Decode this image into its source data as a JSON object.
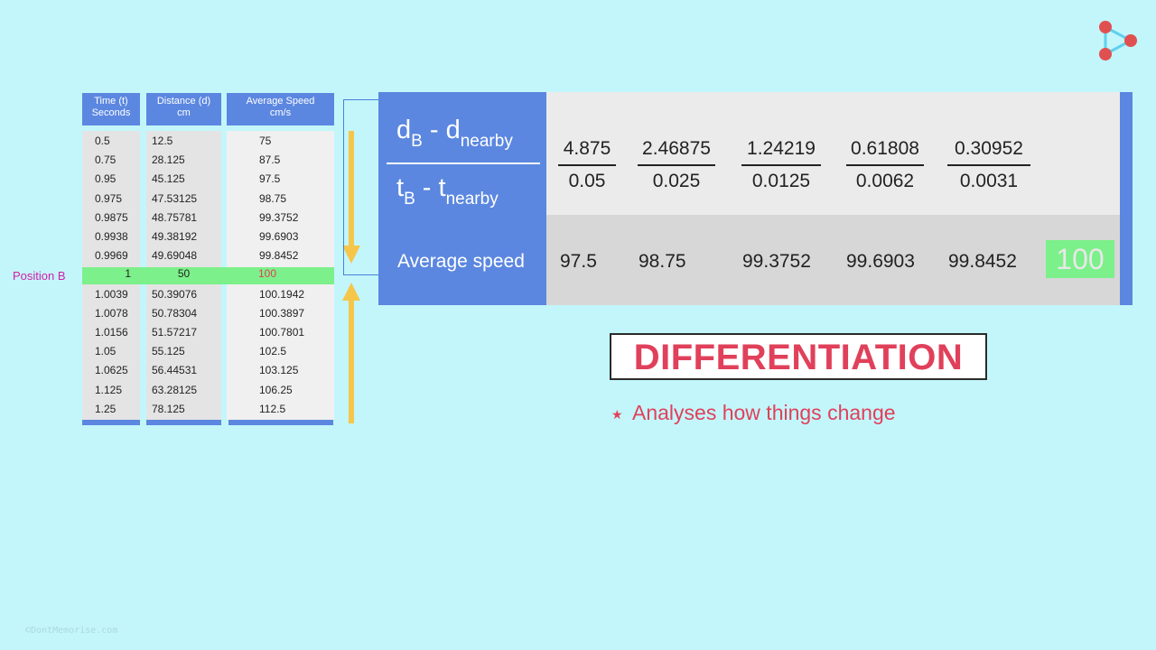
{
  "watermark": "©DontMemorise.com",
  "table": {
    "headers": [
      {
        "line1": "Time (t)",
        "line2": "Seconds"
      },
      {
        "line1": "Distance (d)",
        "line2": "cm"
      },
      {
        "line1": "Average Speed",
        "line2": "cm/s"
      }
    ],
    "rows_above": [
      [
        "0.5",
        "12.5",
        "75"
      ],
      [
        "0.75",
        "28.125",
        "87.5"
      ],
      [
        "0.95",
        "45.125",
        "97.5"
      ],
      [
        "0.975",
        "47.53125",
        "98.75"
      ],
      [
        "0.9875",
        "48.75781",
        "99.3752"
      ],
      [
        "0.9938",
        "49.38192",
        "99.6903"
      ],
      [
        "0.9969",
        "49.69048",
        "99.8452"
      ]
    ],
    "highlight_row": [
      "1",
      "50",
      "100"
    ],
    "rows_below": [
      [
        "1.0039",
        "50.39076",
        "100.1942"
      ],
      [
        "1.0078",
        "50.78304",
        "100.3897"
      ],
      [
        "1.0156",
        "51.57217",
        "100.7801"
      ],
      [
        "1.05",
        "55.125",
        "102.5"
      ],
      [
        "1.0625",
        "56.44531",
        "103.125"
      ],
      [
        "1.125",
        "63.28125",
        "106.25"
      ],
      [
        "1.25",
        "78.125",
        "112.5"
      ]
    ],
    "position_label": "Position B"
  },
  "panel": {
    "num_d": "d",
    "num_sub_b": "B",
    "num_minus": " - d",
    "num_sub_nearby": "nearby",
    "den_t": "t",
    "den_sub_b": "B",
    "den_minus": " - t",
    "den_sub_nearby": "nearby",
    "fractions": [
      {
        "num": "4.875",
        "den": "0.05"
      },
      {
        "num": "2.46875",
        "den": "0.025"
      },
      {
        "num": "1.24219",
        "den": "0.0125"
      },
      {
        "num": "0.61808",
        "den": "0.0062"
      },
      {
        "num": "0.30952",
        "den": "0.0031"
      }
    ],
    "avg_label": "Average speed",
    "avg_values": [
      "97.5",
      "98.75",
      "99.3752",
      "99.6903",
      "99.8452"
    ],
    "avg_final": "100"
  },
  "differentiation": {
    "title": "DIFFERENTIATION",
    "star": "★",
    "bullet": "Analyses how things change"
  },
  "colors": {
    "background": "#c3f6fb",
    "header_blue": "#5b87e0",
    "highlight_green": "#7cf08a",
    "accent_red": "#e1405a",
    "arrow_yellow": "#f5c64a"
  }
}
